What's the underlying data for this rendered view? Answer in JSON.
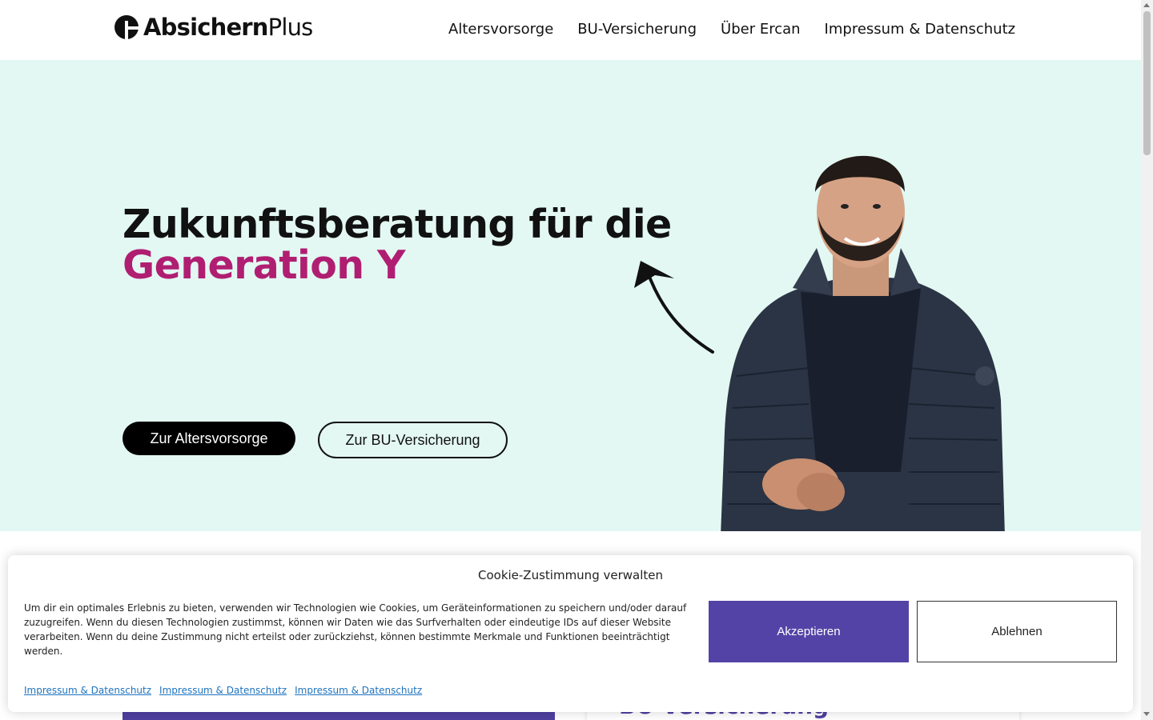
{
  "brand": {
    "name_bold": "Absichern",
    "name_light": "Plus"
  },
  "nav": {
    "items": [
      {
        "label": "Altersvorsorge"
      },
      {
        "label": "BU-Versicherung"
      },
      {
        "label": "Über Ercan"
      },
      {
        "label": "Impressum & Datenschutz"
      }
    ]
  },
  "hero": {
    "title_line1": "Zukunftsberatung für die",
    "title_line2": "Generation Y",
    "primary_button": "Zur Altersvorsorge",
    "secondary_button": "Zur BU-Versicherung"
  },
  "below": {
    "card_title": "BU-Versicherung"
  },
  "cookie": {
    "title": "Cookie-Zustimmung verwalten",
    "text": "Um dir ein optimales Erlebnis zu bieten, verwenden wir Technologien wie Cookies, um Geräteinformationen zu speichern und/oder darauf zuzugreifen. Wenn du diesen Technologien zustimmst, können wir Daten wie das Surfverhalten oder eindeutige IDs auf dieser Website verarbeiten. Wenn du deine Zustimmung nicht erteilst oder zurückziehst, können bestimmte Merkmale und Funktionen beeinträchtigt werden.",
    "accept": "Akzeptieren",
    "reject": "Ablehnen",
    "links": [
      {
        "label": "Impressum & Datenschutz"
      },
      {
        "label": "Impressum & Datenschutz"
      },
      {
        "label": "Impressum & Datenschutz"
      }
    ]
  },
  "colors": {
    "hero_bg": "#e3f8f2",
    "accent_magenta": "#b01e72",
    "cookie_purple": "#5443a6",
    "text": "#111111"
  },
  "icons": {
    "logo": "plus-circle-logo-icon",
    "arrow": "curved-arrow-icon"
  }
}
